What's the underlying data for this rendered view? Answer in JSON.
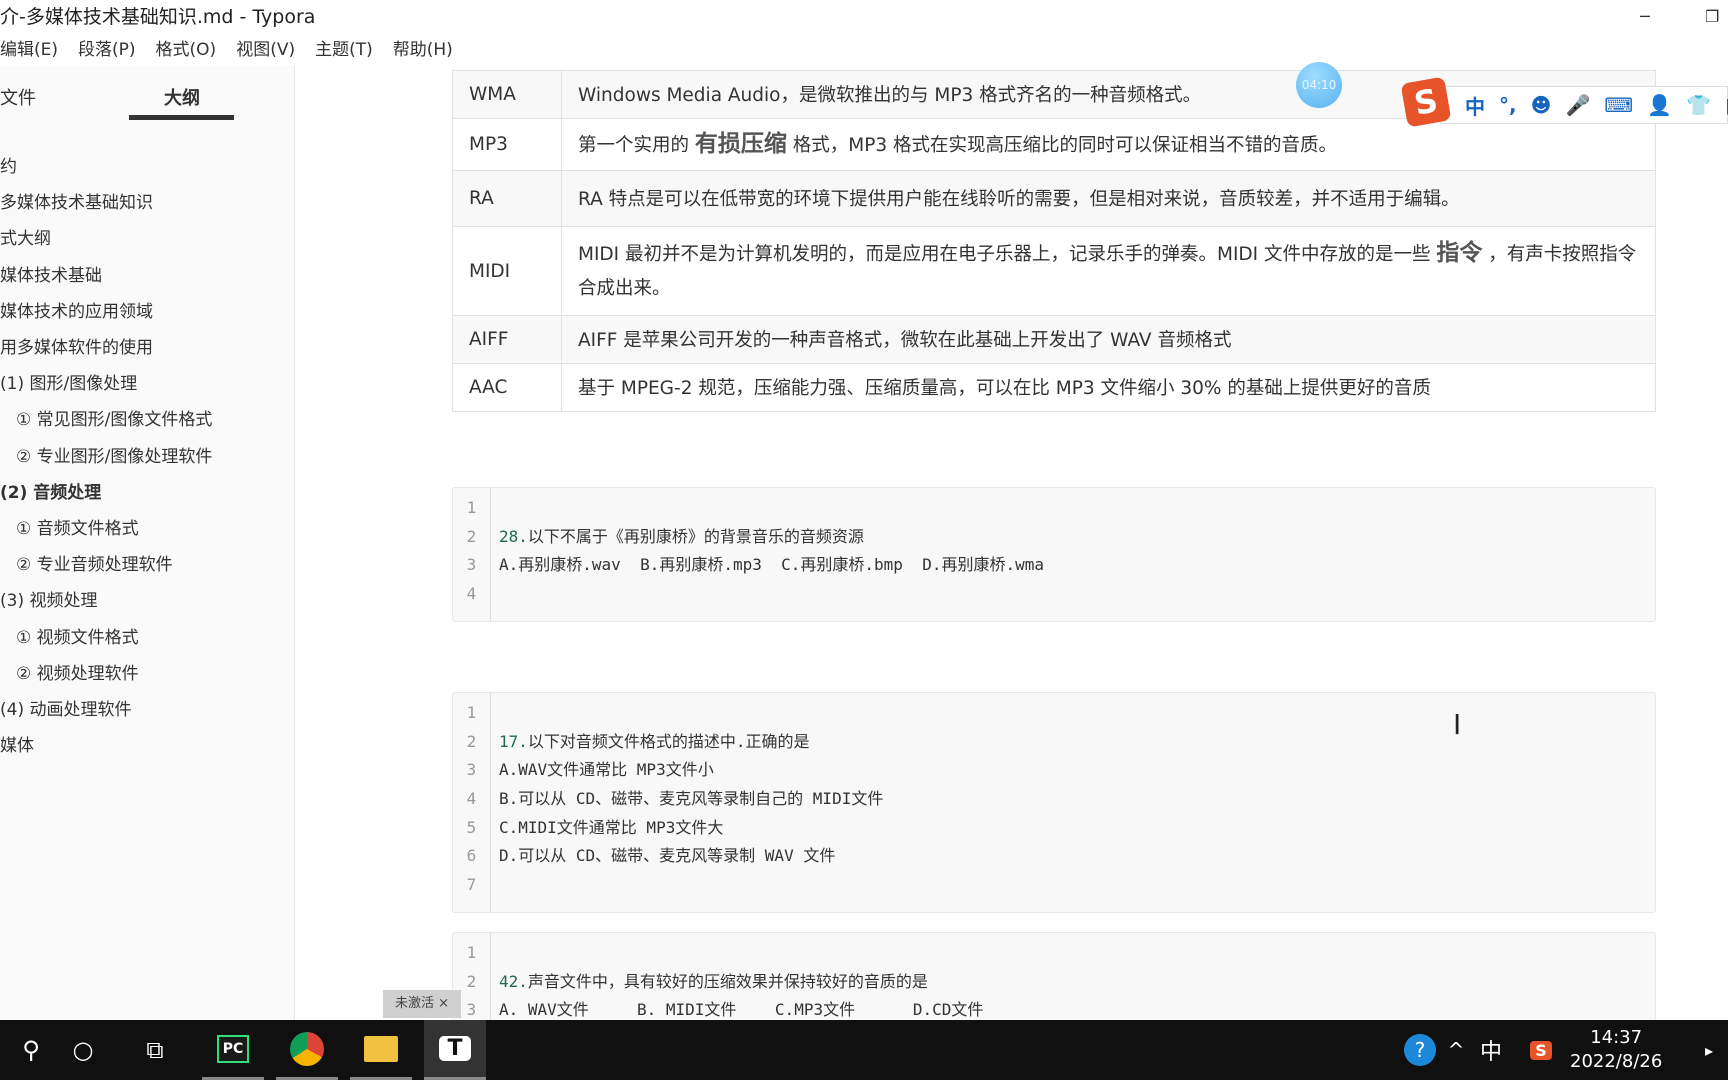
{
  "window": {
    "title": "介-多媒体技术基础知识.md - Typora",
    "minimize": "─",
    "restore": "❐"
  },
  "menu": [
    "编辑(E)",
    "段落(P)",
    "格式(O)",
    "视图(V)",
    "主题(T)",
    "帮助(H)"
  ],
  "sidebar": {
    "tabs": [
      "文件",
      "大纲"
    ],
    "items": [
      {
        "label": "约",
        "indent": 0
      },
      {
        "label": "多媒体技术基础知识",
        "indent": 0
      },
      {
        "label": "式大纲",
        "indent": 0
      },
      {
        "label": "媒体技术基础",
        "indent": 0
      },
      {
        "label": "媒体技术的应用领域",
        "indent": 0
      },
      {
        "label": "用多媒体软件的使用",
        "indent": 0
      },
      {
        "label": "(1) 图形/图像处理",
        "indent": 0
      },
      {
        "label": "① 常见图形/图像文件格式",
        "indent": 1
      },
      {
        "label": "② 专业图形/图像处理软件",
        "indent": 1
      },
      {
        "label": "(2) 音频处理",
        "indent": 0,
        "bold": true
      },
      {
        "label": "① 音频文件格式",
        "indent": 1
      },
      {
        "label": "② 专业音频处理软件",
        "indent": 1
      },
      {
        "label": "(3) 视频处理",
        "indent": 0
      },
      {
        "label": "① 视频文件格式",
        "indent": 1
      },
      {
        "label": "② 视频处理软件",
        "indent": 1
      },
      {
        "label": "(4) 动画处理软件",
        "indent": 0
      },
      {
        "label": "媒体",
        "indent": 0
      }
    ]
  },
  "table": [
    {
      "fmt": "WMA",
      "pre": "Windows Media Audio，是微软推出的与 MP3 格式齐名的一种音频格式。",
      "strong": "",
      "post": ""
    },
    {
      "fmt": "MP3",
      "pre": "第一个实用的 ",
      "strong": "有损压缩",
      "post": " 格式，MP3 格式在实现高压缩比的同时可以保证相当不错的音质。"
    },
    {
      "fmt": "RA",
      "pre": "RA 特点是可以在低带宽的环境下提供用户能在线聆听的需要，但是相对来说，音质较差，并不适用于编辑。",
      "strong": "",
      "post": ""
    },
    {
      "fmt": "MIDI",
      "pre": "MIDI 最初并不是为计算机发明的，而是应用在电子乐器上，记录乐手的弹奏。MIDI 文件中存放的是一些 ",
      "strong": "指令",
      "post": " ，有声卡按照指令合成出来。"
    },
    {
      "fmt": "AIFF",
      "pre": "AIFF 是苹果公司开发的一种声音格式，微软在此基础上开发出了 WAV 音频格式",
      "strong": "",
      "post": ""
    },
    {
      "fmt": "AAC",
      "pre": "基于 MPEG-2 规范，压缩能力强、压缩质量高，可以在比 MP3 文件缩小 30% 的基础上提供更好的音质",
      "strong": "",
      "post": ""
    }
  ],
  "code_blocks": [
    {
      "lines": [
        "",
        "28.|以下不属于《再别康桥》的背景音乐的音频资源",
        "A.再别康桥.wav  B.再别康桥.mp3  C.再别康桥.bmp  D.再别康桥.wma",
        ""
      ]
    },
    {
      "lines": [
        "",
        "17.|以下对音频文件格式的描述中.正确的是",
        "A.WAV文件通常比 MP3文件小",
        "B.可以从 CD、磁带、麦克风等录制自己的 MIDI文件",
        "C.MIDI文件通常比 MP3文件大",
        "D.可以从 CD、磁带、麦克风等录制 WAV 文件",
        ""
      ]
    },
    {
      "lines": [
        "",
        "42.|声音文件中，具有较好的压缩效果并保持较好的音质的是",
        "A. WAV文件     B. MIDI文件    C.MP3文件      D.CD文件"
      ]
    }
  ],
  "overlay": {
    "timer": "04:10",
    "ime_logo": "S",
    "ime_items": [
      "中",
      "°,",
      "☻",
      "🎤",
      "⌨",
      "👤",
      "👕",
      "▦"
    ],
    "activation_tag": "未激活 ×"
  },
  "taskbar": {
    "time": "14:37",
    "date": "2022/8/26",
    "ime": "中",
    "apps": [
      "PC",
      "Chrome",
      "Explorer",
      "T"
    ]
  }
}
